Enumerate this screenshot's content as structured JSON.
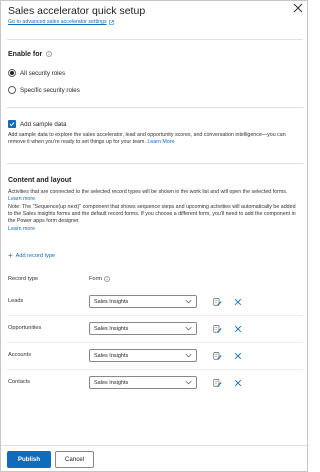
{
  "panel": {
    "title": "Sales accelerator quick setup",
    "advanced_link": "Go to advanced sales accelerator settings"
  },
  "enable_for": {
    "heading": "Enable for",
    "options": [
      {
        "label": "All security roles",
        "selected": true
      },
      {
        "label": "Specific security roles",
        "selected": false
      }
    ]
  },
  "sample_data": {
    "checkbox_label": "Add sample data",
    "checked": true,
    "description": "Add sample data to explore the sales accelerator, lead and opportunity scores, and conversation intelligence—you can remove it when you're ready to set things up for your team.",
    "learn_more": "Learn More"
  },
  "content_layout": {
    "heading": "Content and layout",
    "para1": "Activities that are connected to the selected record types will be shown in the work list and will open the selected forms.",
    "para1_link": "Learn more",
    "note": "Note: The \"Sequence(up next)\" component that shows sequence steps and upcoming activities will automatically be added to the Sales insights forms and the default record forms. If you choose a different form, you'll need to add the component in the Power apps form designer.",
    "note_link": "Learn more",
    "add_record_type": "Add record type",
    "col_record_type": "Record type",
    "col_form": "Form",
    "rows": [
      {
        "record_type": "Leads",
        "form": "Sales Insights"
      },
      {
        "record_type": "Opportunities",
        "form": "Sales Insights"
      },
      {
        "record_type": "Accounts",
        "form": "Sales Insights"
      },
      {
        "record_type": "Contacts",
        "form": "Sales Insights"
      }
    ]
  },
  "footer": {
    "publish": "Publish",
    "cancel": "Cancel"
  },
  "colors": {
    "accent": "#0f6cbd",
    "text": "#201f1e",
    "border": "#8a8886"
  },
  "icons": {
    "close": "close-icon",
    "external_link": "external-link-icon",
    "info": "info-icon",
    "checkmark": "checkmark-icon",
    "add": "plus-icon",
    "chevron": "chevron-down-icon",
    "edit_form": "edit-form-icon",
    "delete": "delete-x-icon"
  }
}
